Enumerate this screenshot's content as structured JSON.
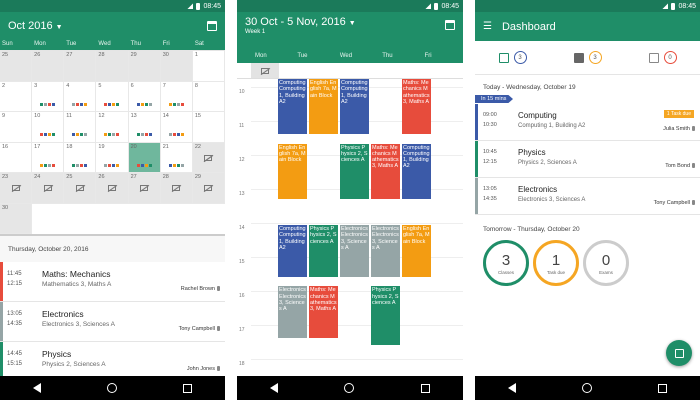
{
  "status": {
    "time": "08:45"
  },
  "month": {
    "title": "Oct 2016",
    "weekdays": [
      "Sun",
      "Mon",
      "Tue",
      "Wed",
      "Thu",
      "Fri",
      "Sat"
    ],
    "day_numbers": [
      "25",
      "26",
      "27",
      "28",
      "29",
      "30",
      "1",
      "2",
      "3",
      "4",
      "5",
      "6",
      "7",
      "8",
      "9",
      "10",
      "11",
      "12",
      "13",
      "14",
      "15",
      "16",
      "17",
      "18",
      "19",
      "20",
      "21",
      "22",
      "23",
      "24",
      "25",
      "26",
      "27",
      "28",
      "29",
      "30"
    ],
    "selected_day": "Thursday, October 20, 2016",
    "lessons": [
      {
        "start": "11:45",
        "end": "12:15",
        "subject": "Maths: Mechanics",
        "room": "Mathematics 3, Maths A",
        "teacher": "Rachel Brown",
        "color": "#e74c3c"
      },
      {
        "start": "13:05",
        "end": "14:35",
        "subject": "Electronics",
        "room": "Electronics 3, Sciences A",
        "teacher": "Tony Campbell",
        "color": "#95a5a6"
      },
      {
        "start": "14:45",
        "end": "15:15",
        "subject": "Physics",
        "room": "Physics 2, Sciences A",
        "teacher": "John Jones",
        "color": "#1f8e68"
      }
    ]
  },
  "week": {
    "title": "30 Oct - 5 Nov, 2016",
    "subtitle": "Week 1",
    "weekdays": [
      "Mon",
      "Tue",
      "Wed",
      "Thu",
      "Fri"
    ],
    "hours": [
      "10",
      "11",
      "12",
      "13",
      "14",
      "15",
      "16",
      "17",
      "18"
    ],
    "events": [
      {
        "day": 0,
        "start": 10.0,
        "end": 11.7,
        "text": "Computing Computing 1, Building A2",
        "color": "#3b5aa8"
      },
      {
        "day": 1,
        "start": 10.0,
        "end": 11.7,
        "text": "English English 7a, Main Block",
        "color": "#f39c12"
      },
      {
        "day": 2,
        "start": 10.0,
        "end": 11.7,
        "text": "Computing Computing 1, Building A2",
        "color": "#3b5aa8"
      },
      {
        "day": 4,
        "start": 10.0,
        "end": 11.7,
        "text": "Maths: Mechanics Mathematics 3, Maths A",
        "color": "#e74c3c"
      },
      {
        "day": 0,
        "start": 11.9,
        "end": 13.6,
        "text": "English English 7a, Main Block",
        "color": "#f39c12"
      },
      {
        "day": 2,
        "start": 11.9,
        "end": 13.6,
        "text": "Physics Physics 2, Sciences A",
        "color": "#1f8e68"
      },
      {
        "day": 3,
        "start": 11.9,
        "end": 13.6,
        "text": "Maths: Mechanics Mathematics 3, Maths A",
        "color": "#e74c3c"
      },
      {
        "day": 4,
        "start": 11.9,
        "end": 13.6,
        "text": "Computing Computing 1, Building A2",
        "color": "#3b5aa8"
      },
      {
        "day": 0,
        "start": 14.3,
        "end": 15.9,
        "text": "Computing Computing 1, Building A2",
        "color": "#3b5aa8"
      },
      {
        "day": 1,
        "start": 14.3,
        "end": 15.9,
        "text": "Physics Physics 2, Sciences A",
        "color": "#1f8e68"
      },
      {
        "day": 2,
        "start": 14.3,
        "end": 15.9,
        "text": "Electronics Electronics 3, Sciences A",
        "color": "#95a5a6"
      },
      {
        "day": 3,
        "start": 14.3,
        "end": 15.9,
        "text": "Electronics Electronics 3, Sciences A",
        "color": "#95a5a6"
      },
      {
        "day": 4,
        "start": 14.3,
        "end": 15.9,
        "text": "English English 7a, Main Block",
        "color": "#f39c12"
      },
      {
        "day": 0,
        "start": 16.1,
        "end": 17.7,
        "text": "Electronics Electronics 3, Sciences A",
        "color": "#95a5a6"
      },
      {
        "day": 1,
        "start": 16.1,
        "end": 17.7,
        "text": "Maths: Mechanics Mathematics 3, Maths A",
        "color": "#e74c3c"
      },
      {
        "day": 3,
        "start": 16.1,
        "end": 17.9,
        "text": "Physics Physics 2, Sciences A",
        "color": "#1f8e68"
      }
    ]
  },
  "dashboard": {
    "title": "Dashboard",
    "tab_counts": [
      "3",
      "3",
      "0"
    ],
    "today_header": "Today - Wednesday, October 19",
    "in_mins": "In 15 mins",
    "lessons": [
      {
        "start": "09:00",
        "end": "10:30",
        "subject": "Computing",
        "room": "Computing 1, Building A2",
        "teacher": "Julia Smith",
        "task": "1 Task due",
        "color": "#3b5aa8"
      },
      {
        "start": "10:45",
        "end": "12:15",
        "subject": "Physics",
        "room": "Physics 2, Sciences A",
        "teacher": "Tom Bond",
        "color": "#1f8e68"
      },
      {
        "start": "13:05",
        "end": "14:35",
        "subject": "Electronics",
        "room": "Electronics 3, Sciences A",
        "teacher": "Tony Campbell",
        "color": "#95a5a6"
      }
    ],
    "tomorrow_header": "Tomorrow - Thursday, October 20",
    "rings": [
      {
        "num": "3",
        "label": "Classes",
        "color": "#1f8e68"
      },
      {
        "num": "1",
        "label": "Task due",
        "color": "#f5a623"
      },
      {
        "num": "0",
        "label": "Exams",
        "color": "#cccccc"
      }
    ]
  }
}
